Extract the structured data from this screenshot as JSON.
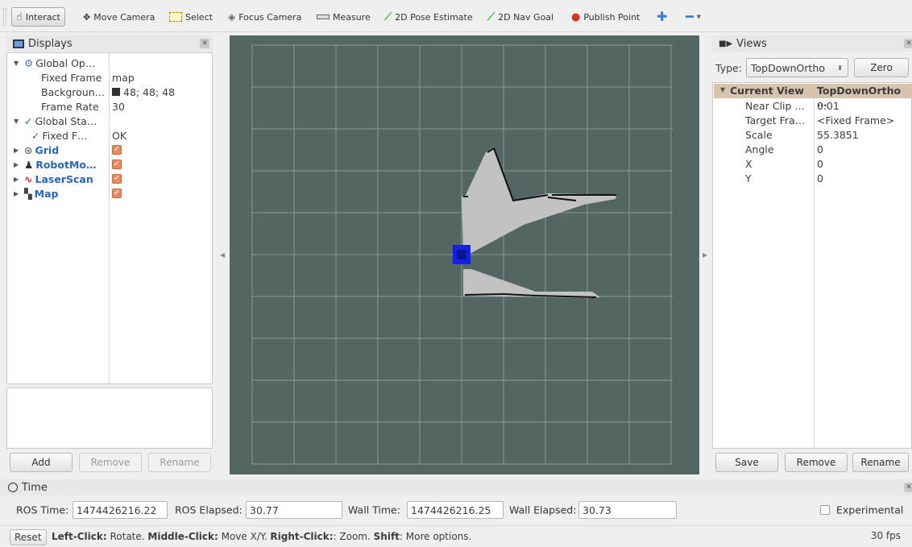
{
  "toolbar": {
    "tools": [
      {
        "label": "Interact",
        "icon": "hand-icon",
        "active": true
      },
      {
        "label": "Move Camera",
        "icon": "move-camera-icon"
      },
      {
        "label": "Select",
        "icon": "select-icon"
      },
      {
        "label": "Focus Camera",
        "icon": "focus-camera-icon"
      },
      {
        "label": "Measure",
        "icon": "ruler-icon"
      },
      {
        "label": "2D Pose Estimate",
        "icon": "green-arrow-icon"
      },
      {
        "label": "2D Nav Goal",
        "icon": "green-arrow-icon"
      },
      {
        "label": "Publish Point",
        "icon": "red-pin-icon"
      }
    ]
  },
  "displays": {
    "title": "Displays",
    "rows": [
      {
        "name": "Global Op…",
        "value": ""
      },
      {
        "name": "Fixed Frame",
        "value": "map"
      },
      {
        "name": "Backgroun…",
        "value": "48; 48; 48"
      },
      {
        "name": "Frame Rate",
        "value": "30"
      },
      {
        "name": "Global Sta…",
        "value": ""
      },
      {
        "name": "Fixed F…",
        "value": "OK"
      },
      {
        "name": "Grid",
        "value": ""
      },
      {
        "name": "RobotMo…",
        "value": ""
      },
      {
        "name": "LaserScan",
        "value": ""
      },
      {
        "name": "Map",
        "value": ""
      }
    ],
    "buttons": {
      "add": "Add",
      "remove": "Remove",
      "rename": "Rename"
    }
  },
  "views": {
    "title": "Views",
    "type_label": "Type:",
    "type_value": "TopDownOrtho",
    "zero": "Zero",
    "current_view_label": "Current View",
    "current_view_value": "TopDownOrtho …",
    "rows": [
      {
        "name": "Near Clip …",
        "value": "0.01"
      },
      {
        "name": "Target Fra…",
        "value": "<Fixed Frame>"
      },
      {
        "name": "Scale",
        "value": "55.3851"
      },
      {
        "name": "Angle",
        "value": "0"
      },
      {
        "name": "X",
        "value": "0"
      },
      {
        "name": "Y",
        "value": "0"
      }
    ],
    "buttons": {
      "save": "Save",
      "remove": "Remove",
      "rename": "Rename"
    }
  },
  "time": {
    "title": "Time",
    "ros_time_label": "ROS Time:",
    "ros_time": "1474426216.22",
    "ros_elapsed_label": "ROS Elapsed:",
    "ros_elapsed": "30.77",
    "wall_time_label": "Wall Time:",
    "wall_time": "1474426216.25",
    "wall_elapsed_label": "Wall Elapsed:",
    "wall_elapsed": "30.73",
    "experimental": "Experimental"
  },
  "status": {
    "reset": "Reset",
    "left_click": "Left-Click:",
    "left_text": " Rotate. ",
    "middle_click": "Middle-Click:",
    "middle_text": " Move X/Y. ",
    "right_click": "Right-Click:",
    "right_text": ": Zoom. ",
    "shift": "Shift",
    "shift_text": ": More options.",
    "fps": "30 fps"
  },
  "colors": {
    "viewport_bg": "#536661",
    "grid_line": "#8a9995",
    "robot": "#1020ee",
    "scan_fill": "#c2c2c2",
    "accent_blue": "#2a67b8",
    "checkbox": "#e9895d",
    "current_view_bg": "#d7c4ae"
  }
}
